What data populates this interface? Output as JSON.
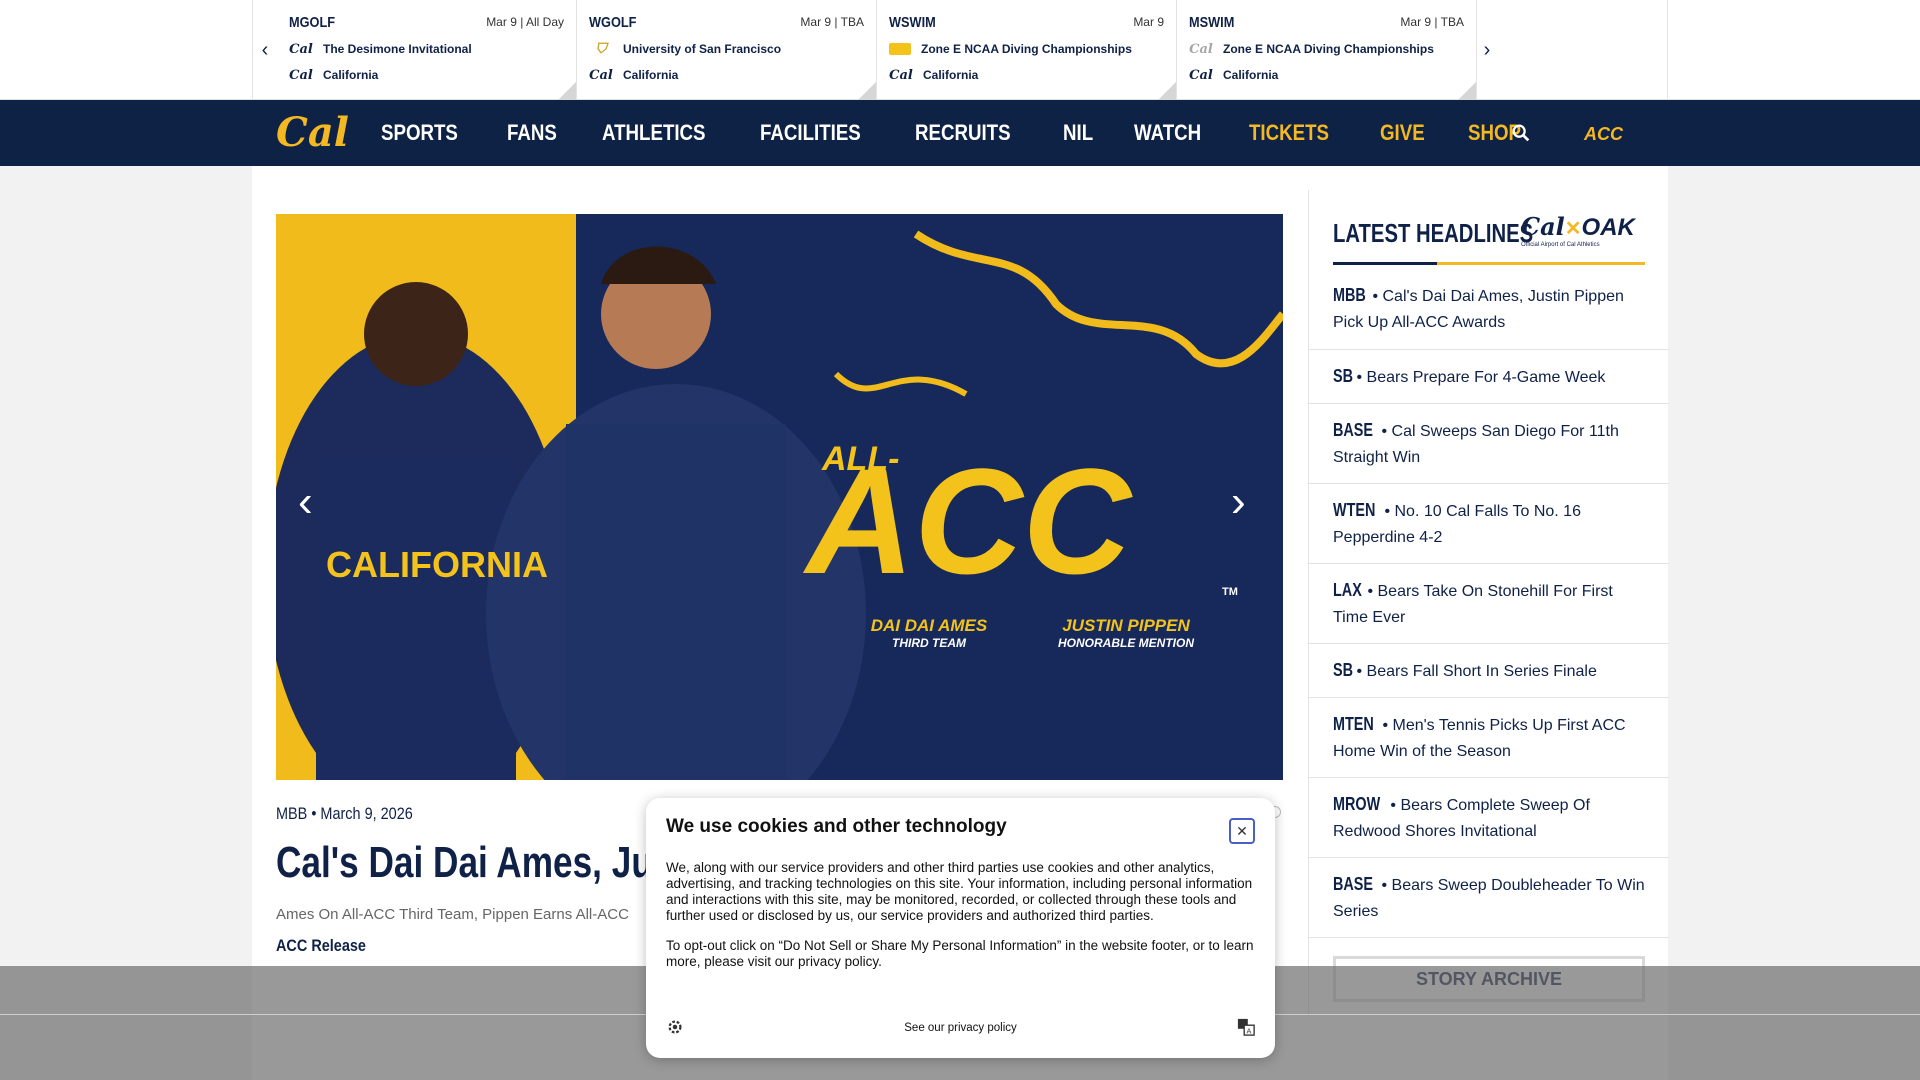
{
  "scores": [
    {
      "sport": "MGOLF",
      "date": "Mar 9 | All Day",
      "opponent_logo": "cal-script-icon",
      "opponent": "The Desimone Invitational",
      "home": "California"
    },
    {
      "sport": "WGOLF",
      "date": "Mar 9 | TBA",
      "opponent_logo": "usf-shield-icon",
      "opponent": "University of San Francisco",
      "home": "California"
    },
    {
      "sport": "WSWIM",
      "date": "Mar 9",
      "opponent_logo": "nau-icon",
      "opponent": "Zone E NCAA Diving Championships",
      "home": "California"
    },
    {
      "sport": "MSWIM",
      "date": "Mar 9 | TBA",
      "opponent_logo": "cal-script-icon",
      "opponent": "Zone E NCAA Diving Championships",
      "home": "California"
    }
  ],
  "nav": {
    "logo": "Cal",
    "items": [
      "SPORTS",
      "FANS",
      "ATHLETICS",
      "FACILITIES",
      "RECRUITS",
      "NIL",
      "WATCH"
    ],
    "gold_items": [
      "TICKETS",
      "GIVE",
      "SHOP"
    ],
    "conference": "ACC"
  },
  "hero": {
    "headline_small": "ALL-",
    "headline_big": "ACC",
    "tm": "TM",
    "player1_name": "DAI DAI AMES",
    "player1_honor": "THIRD TEAM",
    "player2_name": "JUSTIN PIPPEN",
    "player2_honor": "HONORABLE MENTION",
    "jersey_text": "CALIFORNIA"
  },
  "story": {
    "meta": "MBB • March 9, 2026",
    "title": "Cal's Dai Dai Ames, Justi",
    "subtitle": "Ames On All-ACC Third Team, Pippen Earns All-ACC",
    "link": "ACC Release"
  },
  "sidebar": {
    "title": "LATEST HEADLINES",
    "sponsor": "OAK",
    "sponsor_sub": "Official Airport of Cal Athletics",
    "headlines": [
      {
        "tag": "MBB",
        "text": "Cal's Dai Dai Ames, Justin Pippen Pick Up All-ACC Awards"
      },
      {
        "tag": "SB",
        "text": "Bears Prepare For 4-Game Week"
      },
      {
        "tag": "BASE",
        "text": "Cal Sweeps San Diego For 11th Straight Win"
      },
      {
        "tag": "WTEN",
        "text": "No. 10 Cal Falls To No. 16 Pepperdine 4-2"
      },
      {
        "tag": "LAX",
        "text": "Bears Take On Stonehill For First Time Ever"
      },
      {
        "tag": "SB",
        "text": "Bears Fall Short In Series Finale"
      },
      {
        "tag": "MTEN",
        "text": "Men's Tennis Picks Up First ACC Home Win of the Season"
      },
      {
        "tag": "MROW",
        "text": "Bears Complete Sweep Of Redwood Shores Invitational"
      },
      {
        "tag": "BASE",
        "text": "Bears Sweep Doubleheader To Win Series"
      }
    ],
    "archive": "STORY ARCHIVE"
  },
  "cookie": {
    "title": "We use cookies and other technology",
    "body1": "We, along with our service providers and other third parties use cookies and other analytics, advertising, and tracking technologies on this site. Your information, including personal information and interactions with this site, may be monitored, recorded, or collected through these tools and further used or disclosed by us, our service providers and authorized third parties.",
    "body2": "To opt-out click on “Do Not Sell or Share My Personal Information” in the website footer, or to learn more, please visit our privacy policy.",
    "privacy_link": "See our privacy policy"
  },
  "colors": {
    "navy": "#0e2245",
    "gold": "#f4b823"
  }
}
